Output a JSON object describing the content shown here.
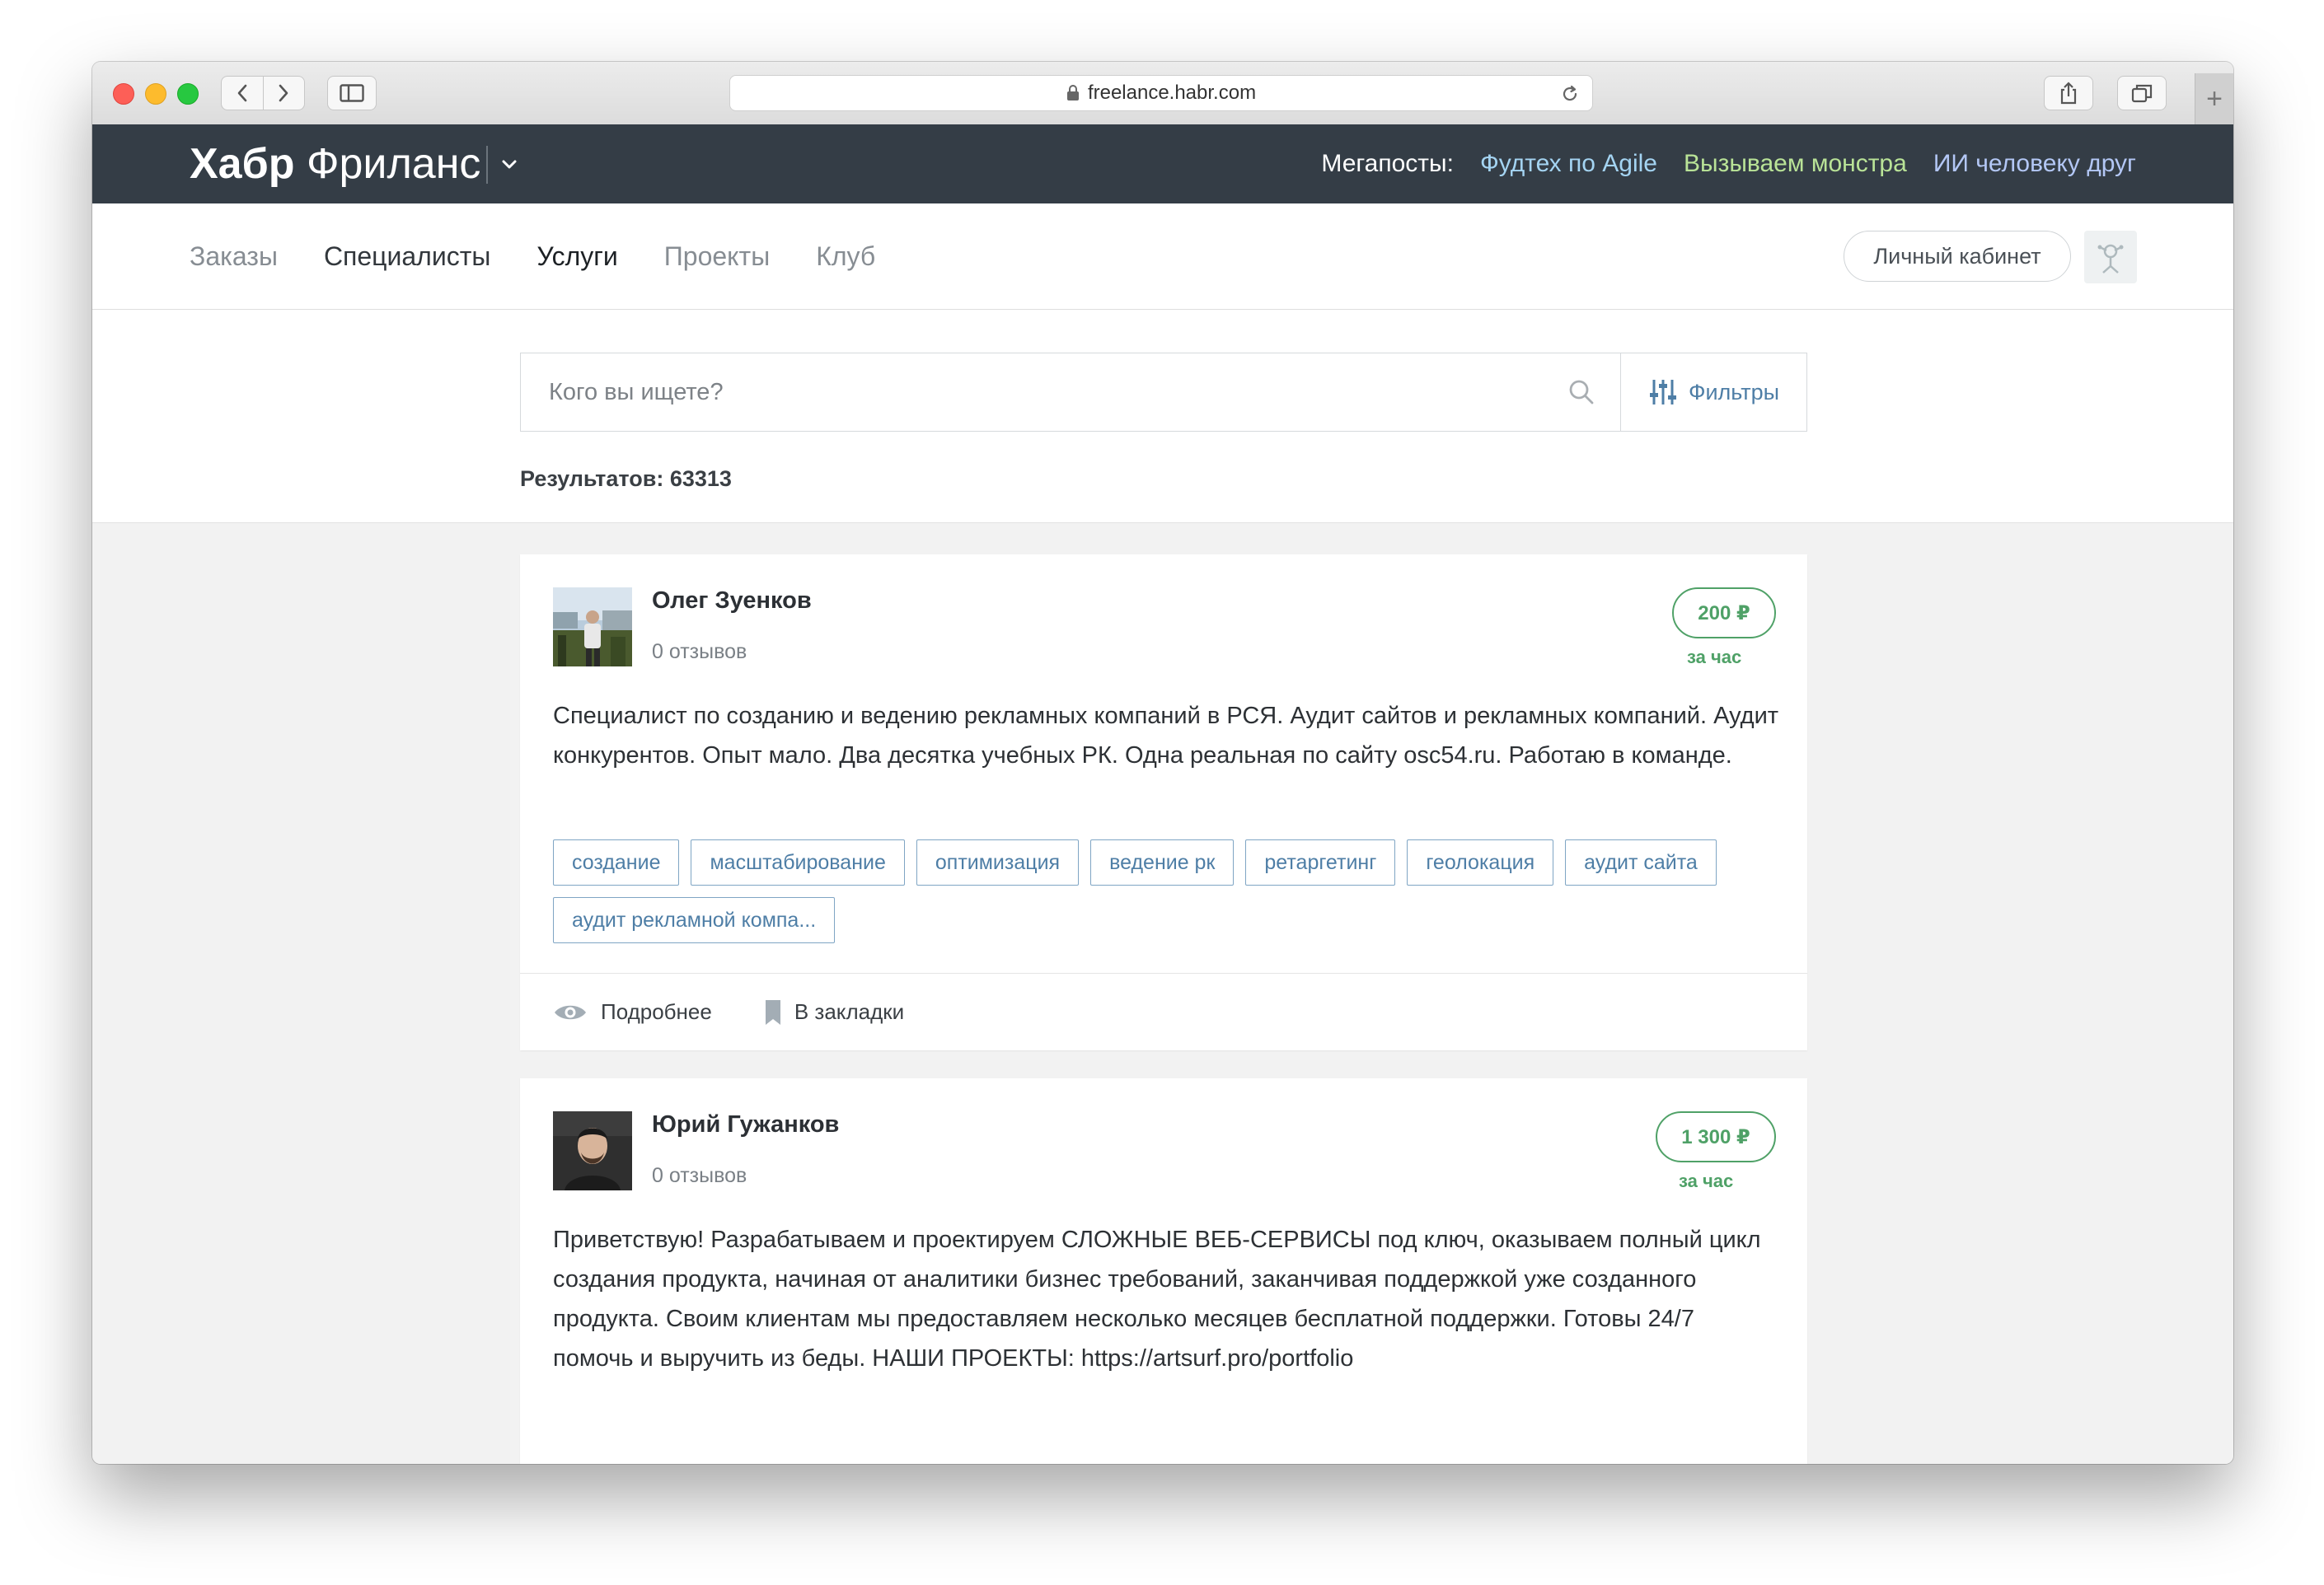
{
  "browser": {
    "url": "freelance.habr.com"
  },
  "header": {
    "logo_bold": "Хабр",
    "logo_light": "Фриланс",
    "megaposts_label": "Мегапосты:",
    "megaposts": [
      "Фудтех по Agile",
      "Вызываем монстра",
      "ИИ человеку друг"
    ],
    "colors": {
      "bg": "#343d46",
      "mp1": "#a4d4f2",
      "mp2": "#b9e397",
      "mp3": "#b3c7f5"
    }
  },
  "nav": {
    "items": [
      "Заказы",
      "Специалисты",
      "Услуги",
      "Проекты",
      "Клуб"
    ],
    "active": "Услуги",
    "cabinet_label": "Личный кабинет"
  },
  "search": {
    "placeholder": "Кого вы ищете?",
    "filters_label": "Фильтры",
    "results_text": "Результатов: 63313"
  },
  "cards": [
    {
      "name": "Олег Зуенков",
      "reviews": "0 отзывов",
      "price": "200 ₽",
      "per": "за час",
      "description": "Специалист по созданию и ведению рекламных компаний в РСЯ. Аудит сайтов и рекламных компаний. Аудит конкурентов. Опыт мало. Два десятка учебных РК. Одна реальная по сайту osc54.ru. Работаю в команде.",
      "tags": [
        "создание",
        "масштабирование",
        "оптимизация",
        "ведение рк",
        "ретаргетинг",
        "геолокация",
        "аудит сайта",
        "аудит рекламной компа..."
      ],
      "details_label": "Подробнее",
      "bookmark_label": "В закладки"
    },
    {
      "name": "Юрий Гужанков",
      "reviews": "0 отзывов",
      "price": "1 300 ₽",
      "per": "за час",
      "description": "Приветствую!   Разрабатываем и проектируем СЛОЖНЫЕ ВЕБ-СЕРВИСЫ под ключ, оказываем полный цикл создания продукта, начиная от аналитики бизнес требований, заканчивая поддержкой уже созданного продукта. Своим клиентам мы предоставляем несколько месяцев бесплатной поддержки. Готовы 24/7 помочь и выручить из беды. НАШИ ПРОЕКТЫ: https://artsurf.pro/portfolio"
    }
  ],
  "accent_green": "#4fa167",
  "accent_blue": "#4e7ea6"
}
